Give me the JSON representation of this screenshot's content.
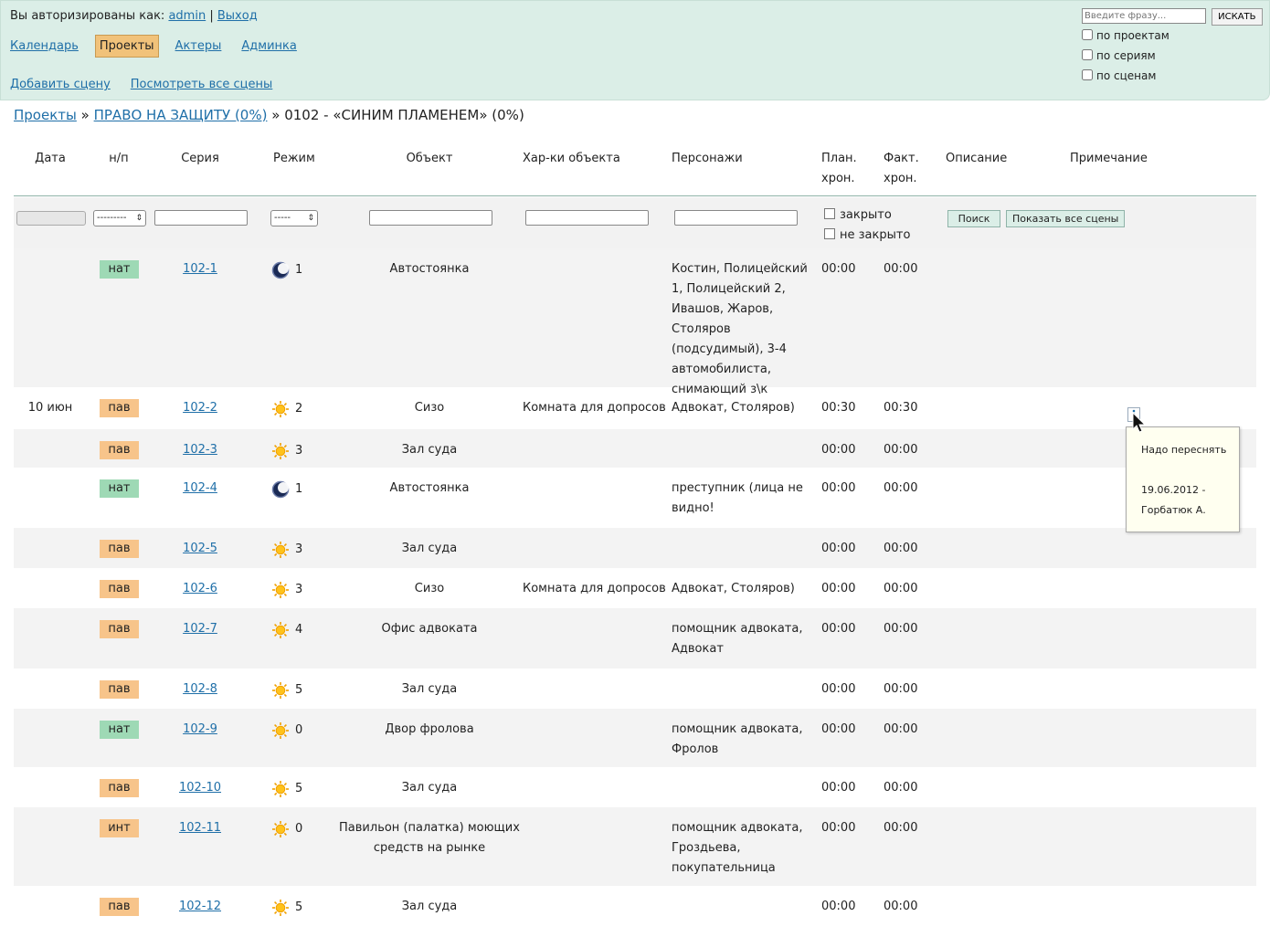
{
  "header": {
    "auth_prefix": "Вы авторизированы как:",
    "user": "admin",
    "separator": "|",
    "logout": "Выход",
    "nav": [
      "Календарь",
      "Проекты",
      "Актеры",
      "Админка"
    ],
    "active_nav": "Проекты",
    "subnav": [
      "Добавить сцену",
      "Посмотреть все сцены"
    ],
    "search": {
      "placeholder": "Введите фразу...",
      "button": "ИСКАТЬ",
      "options": [
        "по проектам",
        "по сериям",
        "по сценам"
      ]
    }
  },
  "breadcrumb": {
    "projects": "Проекты",
    "sep": "»",
    "project": "ПРАВО НА ЗАЩИТУ (0%)",
    "current": "0102 - «СИНИМ ПЛАМЕНЕМ» (0%)"
  },
  "columns": {
    "date": "Дата",
    "np": "н/п",
    "series": "Серия",
    "mode": "Режим",
    "object": "Объект",
    "char": "Хар-ки объекта",
    "persons": "Персонажи",
    "plan1": "План.",
    "plan2": "хрон.",
    "fact1": "Факт.",
    "fact2": "хрон.",
    "desc": "Описание",
    "note": "Примечание"
  },
  "filters": {
    "np_value": "---------",
    "mode_value": "-----",
    "closed": "закрыто",
    "not_closed": "не закрыто",
    "search_btn": "Поиск",
    "show_all_btn": "Показать все сцены"
  },
  "rows": [
    {
      "date": "",
      "np": "нат",
      "series": "102-1",
      "mode_icon": "moon",
      "mode": "1",
      "object": "Автостоянка",
      "char": "",
      "persons": "Костин, Полицейский 1, Полицейский 2, Ивашов, Жаров, Столяров (подсудимый), 3-4 автомобилиста, снимающий з\\к",
      "plan": "00:00",
      "fact": "00:00"
    },
    {
      "date": "10 июн",
      "np": "пав",
      "series": "102-2",
      "mode_icon": "sun",
      "mode": "2",
      "object": "Сизо",
      "char": "Комната для допросов",
      "persons": "Адвокат, Столяров)",
      "plan": "00:30",
      "fact": "00:30"
    },
    {
      "date": "",
      "np": "пав",
      "series": "102-3",
      "mode_icon": "sun",
      "mode": "3",
      "object": "Зал суда",
      "char": "",
      "persons": "",
      "plan": "00:00",
      "fact": "00:00"
    },
    {
      "date": "",
      "np": "нат",
      "series": "102-4",
      "mode_icon": "moon",
      "mode": "1",
      "object": "Автостоянка",
      "char": "",
      "persons": "преступник (лица не видно!",
      "plan": "00:00",
      "fact": "00:00"
    },
    {
      "date": "",
      "np": "пав",
      "series": "102-5",
      "mode_icon": "sun",
      "mode": "3",
      "object": "Зал суда",
      "char": "",
      "persons": "",
      "plan": "00:00",
      "fact": "00:00"
    },
    {
      "date": "",
      "np": "пав",
      "series": "102-6",
      "mode_icon": "sun",
      "mode": "3",
      "object": "Сизо",
      "char": "Комната для допросов",
      "persons": "Адвокат, Столяров)",
      "plan": "00:00",
      "fact": "00:00"
    },
    {
      "date": "",
      "np": "пав",
      "series": "102-7",
      "mode_icon": "sun",
      "mode": "4",
      "object": "Офис адвоката",
      "char": "",
      "persons": "помощник адвоката, Адвокат",
      "plan": "00:00",
      "fact": "00:00"
    },
    {
      "date": "",
      "np": "пав",
      "series": "102-8",
      "mode_icon": "sun",
      "mode": "5",
      "object": "Зал суда",
      "char": "",
      "persons": "",
      "plan": "00:00",
      "fact": "00:00"
    },
    {
      "date": "",
      "np": "нат",
      "series": "102-9",
      "mode_icon": "sun",
      "mode": "0",
      "object": "Двор фролова",
      "char": "",
      "persons": "помощник адвоката, Фролов",
      "plan": "00:00",
      "fact": "00:00"
    },
    {
      "date": "",
      "np": "пав",
      "series": "102-10",
      "mode_icon": "sun",
      "mode": "5",
      "object": "Зал суда",
      "char": "",
      "persons": "",
      "plan": "00:00",
      "fact": "00:00"
    },
    {
      "date": "",
      "np": "инт",
      "series": "102-11",
      "mode_icon": "sun",
      "mode": "0",
      "object": "Павильон (палатка) моющих средств на рынке",
      "char": "",
      "persons": "помощник адвоката, Гроздьева, покупательница",
      "plan": "00:00",
      "fact": "00:00"
    },
    {
      "date": "",
      "np": "пав",
      "series": "102-12",
      "mode_icon": "sun",
      "mode": "5",
      "object": "Зал суда",
      "char": "",
      "persons": "",
      "plan": "00:00",
      "fact": "00:00"
    }
  ],
  "tooltip": {
    "line1": "Надо переснять",
    "line2": "19.06.2012 -",
    "line3": "Горбатюк А."
  }
}
